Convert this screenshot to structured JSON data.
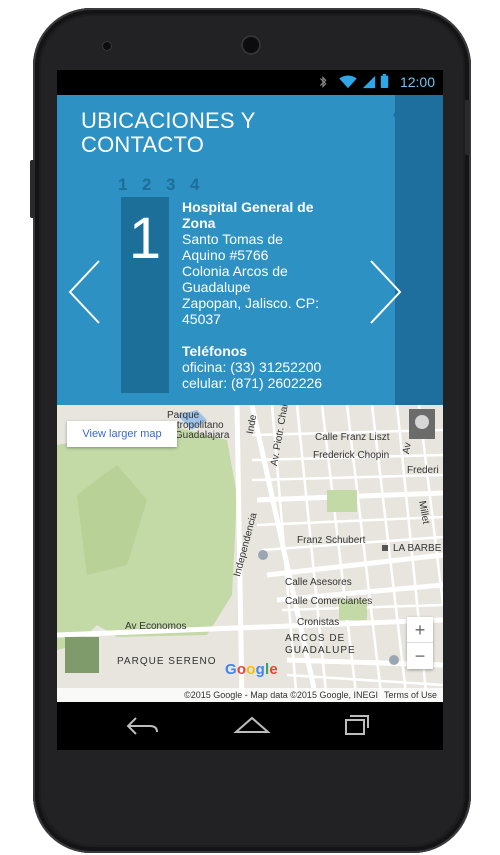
{
  "status_bar": {
    "time": "12:00"
  },
  "header": {
    "title_line1": "UBICACIONES Y",
    "title_line2": "CONTACTO",
    "pager": [
      "1",
      "2",
      "3",
      "4"
    ],
    "current_number": "1",
    "location": {
      "name_line1": "Hospital General de",
      "name_line2": "Zona",
      "address": [
        "Santo Tomas de",
        "Aquino #5766",
        "Colonia Arcos de",
        "Guadalupe",
        "Zapopan, Jalisco. CP:",
        "45037"
      ],
      "phones_title": "Teléfonos",
      "phone_office": "oficina: (33) 31252200",
      "phone_cell": "celular: (871) 2602226"
    }
  },
  "map": {
    "view_larger": "View larger map",
    "labels": {
      "parque_line1": "Parque",
      "parque_line2": "Metropolitano",
      "parque_line3": "de Guadalajara",
      "franz_liszt": "Calle Franz Liszt",
      "chopin": "Frederick Chopin",
      "frederi": "Frederi",
      "chaikovski": "Av. Piotr. Chaikovski",
      "millet": "Millet",
      "independencia": "Independencia",
      "schubert": "Franz Schubert",
      "barbera": "LA BARBE",
      "asesores": "Calle Asesores",
      "comerciantes": "Calle Comerciantes",
      "cronistas": "Cronistas",
      "economos": "Av Economos",
      "arcos1": "ARCOS DE",
      "arcos2": "GUADALUPE",
      "sereno": "PARQUE SERENO",
      "av": "Av",
      "inde": "Inde"
    },
    "zoom_in": "+",
    "zoom_out": "−",
    "google_letters": [
      "G",
      "o",
      "o",
      "g",
      "l",
      "e"
    ],
    "credits": "©2015 Google - Map data ©2015 Google, INEGI",
    "terms": "Terms of Use"
  },
  "colors": {
    "header_bg": "#2d91c4",
    "ribbon": "#1f6f9e",
    "accent": "#2ea7e8"
  },
  "icons": [
    "bluetooth-icon",
    "wifi-icon",
    "signal-icon",
    "battery-icon",
    "back-icon",
    "home-icon",
    "recents-icon",
    "chevron-left-icon",
    "chevron-right-icon",
    "pegman-icon"
  ]
}
